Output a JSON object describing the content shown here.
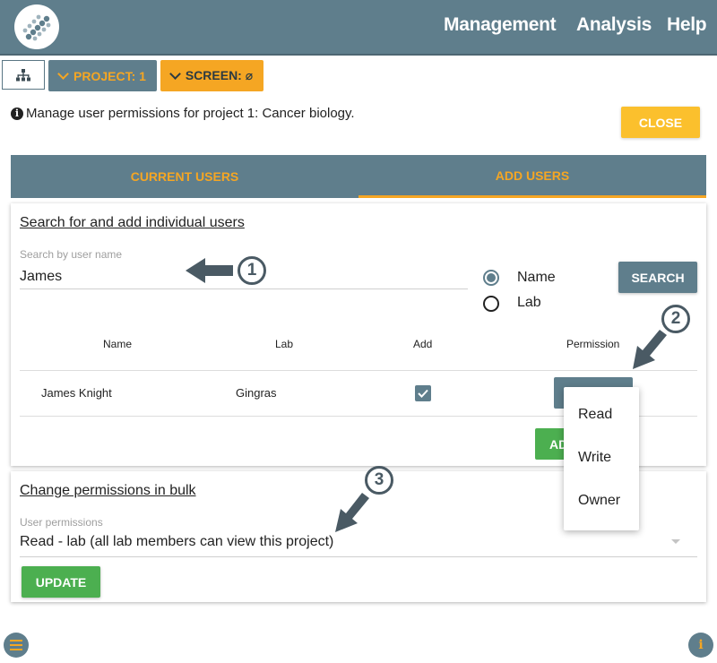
{
  "navbar": {
    "links": [
      "Management",
      "Analysis",
      "Help"
    ],
    "bg_color": "#5f7e8c"
  },
  "toolbar": {
    "hierarchy_icon": "hierarchy-icon",
    "project_label": "PROJECT: 1",
    "screen_label": "SCREEN: ⌀"
  },
  "info": {
    "icon": "info-icon",
    "text": "Manage user permissions for project 1: Cancer biology.",
    "close_label": "CLOSE"
  },
  "tabs": [
    {
      "label": "CURRENT USERS",
      "active": false
    },
    {
      "label": "ADD USERS",
      "active": true
    }
  ],
  "individual": {
    "title": "Search for and add individual users",
    "search_label": "Search by user name",
    "search_value": "James",
    "radio_options": [
      {
        "label": "Name",
        "checked": true
      },
      {
        "label": "Lab",
        "checked": false
      }
    ],
    "search_button": "SEARCH",
    "table": {
      "headers": [
        "Name",
        "Lab",
        "Add",
        "Permission"
      ],
      "rows": [
        {
          "name": "James Knight",
          "lab": "Gingras",
          "add": true
        }
      ]
    },
    "add_button": "ADD",
    "permission_menu": [
      "Read",
      "Write",
      "Owner"
    ]
  },
  "bulk": {
    "title": "Change permissions in bulk",
    "select_label": "User permissions",
    "select_value": "Read - lab (all lab members can view this project)",
    "update_button": "UPDATE"
  },
  "annotations": [
    "1",
    "2",
    "3"
  ],
  "colors": {
    "accent": "#f5a623",
    "primary": "#5f7e8c",
    "success": "#4caf50",
    "warning": "#fbc02d"
  }
}
